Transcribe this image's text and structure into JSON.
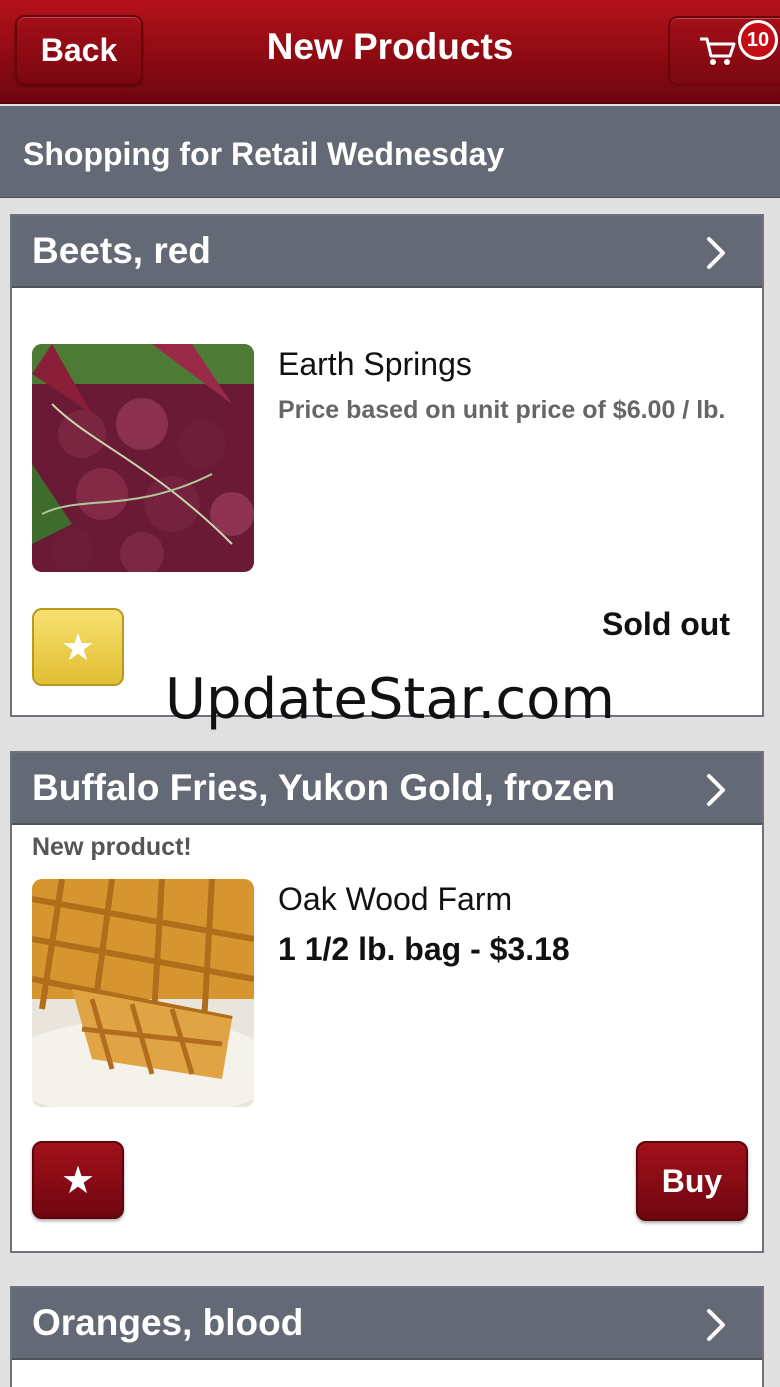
{
  "header": {
    "back_label": "Back",
    "title": "New Products",
    "cart_count": "10"
  },
  "subheader": {
    "text": "Shopping for Retail Wednesday"
  },
  "products": [
    {
      "name": "Beets, red",
      "badge": "",
      "vendor": "Earth Springs",
      "price_note": "Price based on unit price of $6.00 / lb.",
      "price": "",
      "status": "Sold out",
      "favorite_icon": "star-icon"
    },
    {
      "name": "Buffalo Fries, Yukon Gold, frozen",
      "badge": "New product!",
      "vendor": "Oak Wood Farm",
      "price_note": "",
      "price": "1 1/2 lb. bag - $3.18",
      "buy_label": "Buy",
      "favorite_icon": "star-icon"
    },
    {
      "name": "Oranges, blood"
    }
  ],
  "watermark": "UpdateStar.com",
  "colors": {
    "header_red": "#9e0e16",
    "section_gray": "#646a75",
    "favorite_yellow": "#ecd04c",
    "button_red": "#8a0a13"
  }
}
